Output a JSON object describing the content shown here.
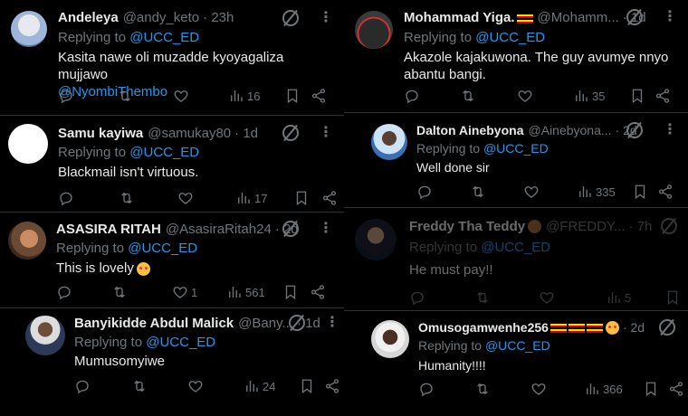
{
  "left_column": [
    {
      "name": "Andeleya",
      "handle": "@andy_keto",
      "time": "· 23h",
      "replying_prefix": "Replying to ",
      "replying_to": "@UCC_ED",
      "text_lines": [
        "Kasita nawe oli muzadde kyoyagaliza mujjawo"
      ],
      "mention": "@NyombiThembo",
      "replies": "",
      "retweets": "",
      "likes": "",
      "views": "16"
    },
    {
      "name": "Samu kayiwa",
      "handle": "@samukay80",
      "time": "· 1d",
      "replying_prefix": "Replying to ",
      "replying_to": "@UCC_ED",
      "text": "Blackmail isn't virtuous.",
      "replies": "",
      "retweets": "",
      "likes": "",
      "views": "17"
    },
    {
      "name": "ASASIRA RITAH",
      "handle": "@AsasiraRitah24",
      "time": "· 2d",
      "replying_prefix": "Replying to ",
      "replying_to": "@UCC_ED",
      "text": "This is lovely",
      "replies": "",
      "retweets": "",
      "likes": "1",
      "views": "561"
    },
    {
      "name": "Banyikidde Abdul Malick",
      "handle": "@Bany...",
      "time": "· 1d",
      "replying_prefix": "Replying to ",
      "replying_to": "@UCC_ED",
      "text": "Mumusomyiwe",
      "replies": "",
      "retweets": "",
      "likes": "",
      "views": "24"
    }
  ],
  "right_column": [
    {
      "name": "Mohammad Yiga.",
      "handle": "@Mohamm...",
      "time": "· 1d",
      "replying_prefix": "Replying to ",
      "replying_to": "@UCC_ED",
      "text_lines": [
        "Akazole kajakuwona. The guy avumye nnyo",
        "abantu bangi."
      ],
      "replies": "",
      "retweets": "",
      "likes": "",
      "views": "35"
    },
    {
      "name": "Dalton Ainebyona",
      "handle": "@Ainebyona...",
      "time": "· 2d",
      "replying_prefix": "Replying to ",
      "replying_to": "@UCC_ED",
      "text": "Well done sir",
      "replies": "",
      "retweets": "",
      "likes": "",
      "views": "335"
    },
    {
      "name": "Freddy Tha Teddy",
      "handle": "@FREDDY...",
      "time": "· 7h",
      "replying_prefix": "Replying to ",
      "replying_to": "@UCC_ED",
      "text": "He must pay!!",
      "replies": "",
      "retweets": "",
      "likes": "",
      "views": "5"
    },
    {
      "name": "Omusogamwenhe256",
      "handle": "",
      "time": "· 2d",
      "replying_prefix": "Replying to ",
      "replying_to": "@UCC_ED",
      "text": "Humanity!!!!",
      "replies": "",
      "retweets": "",
      "likes": "",
      "views": "366"
    }
  ],
  "icons": {
    "reply": "reply-icon",
    "retweet": "retweet-icon",
    "like": "heart-icon",
    "views": "views-icon",
    "bookmark": "bookmark-icon",
    "share": "share-icon",
    "grok": "grok-icon",
    "more": "more-icon"
  },
  "colors": {
    "background": "#000000",
    "text": "#e7e9ea",
    "secondary": "#71767b",
    "link": "#1d9bf0",
    "divider": "#2f3336"
  }
}
